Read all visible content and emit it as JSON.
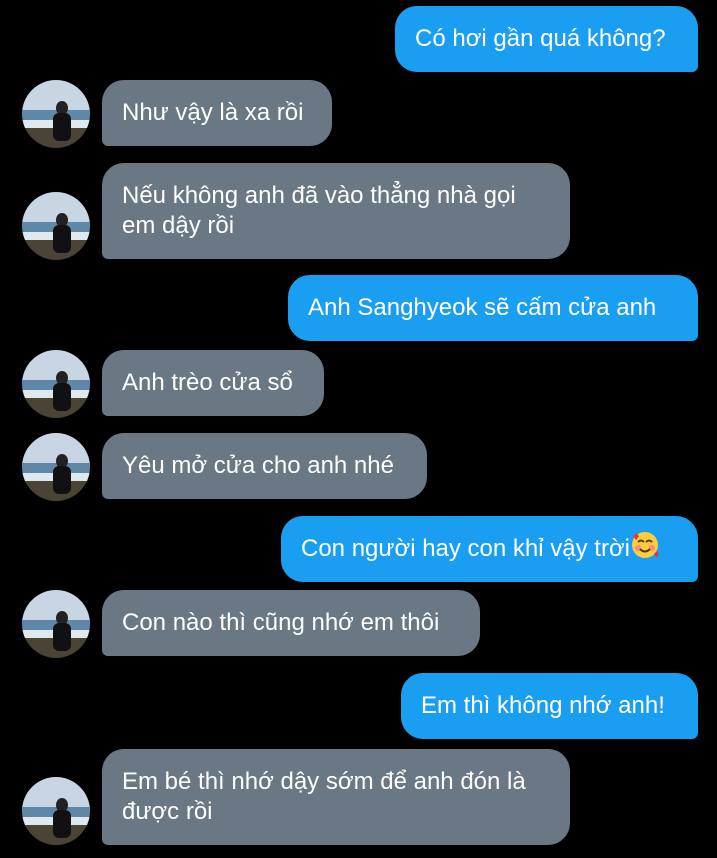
{
  "messages": [
    {
      "side": "sent",
      "text": "Có hơi gần quá không?"
    },
    {
      "side": "received",
      "text": "Như vậy là xa rồi"
    },
    {
      "side": "received",
      "text": "Nếu không anh đã vào thẳng nhà gọi em dậy rồi"
    },
    {
      "side": "sent",
      "text": "Anh Sanghyeok sẽ cấm cửa anh"
    },
    {
      "side": "received",
      "text": "Anh trèo cửa sổ"
    },
    {
      "side": "received",
      "text": "Yêu mở cửa cho anh nhé"
    },
    {
      "side": "sent",
      "text": "Con người hay con khỉ vậy trời",
      "emoji": "smiling-face-with-hearts"
    },
    {
      "side": "received",
      "text": "Con nào thì cũng nhớ em thôi"
    },
    {
      "side": "sent",
      "text": "Em thì không nhớ anh!"
    },
    {
      "side": "received",
      "text": "Em bé thì nhớ dậy sớm để anh đón là được rồi"
    }
  ],
  "colors": {
    "background": "#000000",
    "sent_bubble": "#1a9ef1",
    "received_bubble": "#6a7785",
    "text": "#ffffff"
  }
}
